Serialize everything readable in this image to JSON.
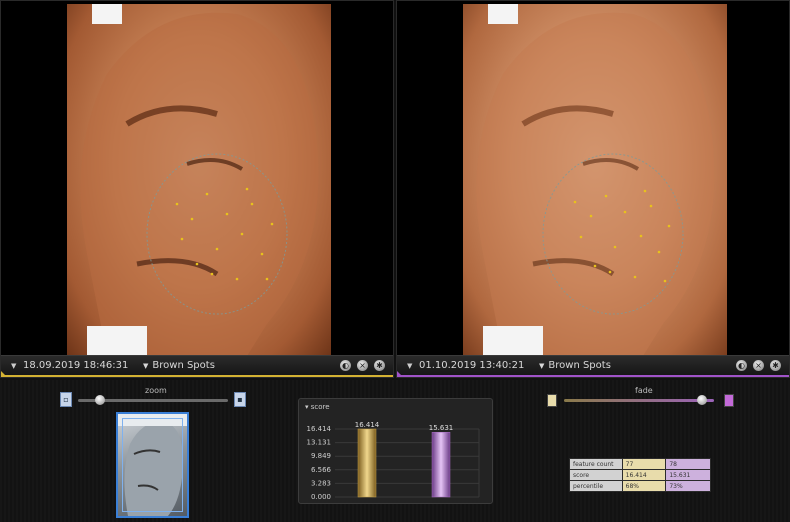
{
  "left_viewer": {
    "date": "18.09.2019 18:46:31",
    "mode": "Brown Spots",
    "accent": "#d4b233"
  },
  "right_viewer": {
    "date": "01.10.2019 13:40:21",
    "mode": "Brown Spots",
    "accent": "#a053c8"
  },
  "zoom": {
    "label": "zoom",
    "level": 0.12
  },
  "fade": {
    "label": "fade",
    "level": 0.95
  },
  "score": {
    "title": "score",
    "chart_data": {
      "type": "bar",
      "categories": [
        "18.09.2019 18:46:31",
        "01.10.2019 13:40:21"
      ],
      "values": [
        16.414,
        15.631
      ],
      "ticks": [
        "16.414",
        "13.131",
        "9.849",
        "6.566",
        "3.283",
        "0.000"
      ],
      "data_labels": [
        "16.414",
        "15.631"
      ],
      "ylim": [
        0,
        16.414
      ],
      "colors": [
        "#c9a34a",
        "#a86cc2"
      ]
    }
  },
  "stats": {
    "rows": [
      {
        "label": "feature count",
        "a": "77",
        "b": "78"
      },
      {
        "label": "score",
        "a": "16.414",
        "b": "15.631"
      },
      {
        "label": "percentile",
        "a": "68%",
        "b": "73%"
      }
    ]
  }
}
